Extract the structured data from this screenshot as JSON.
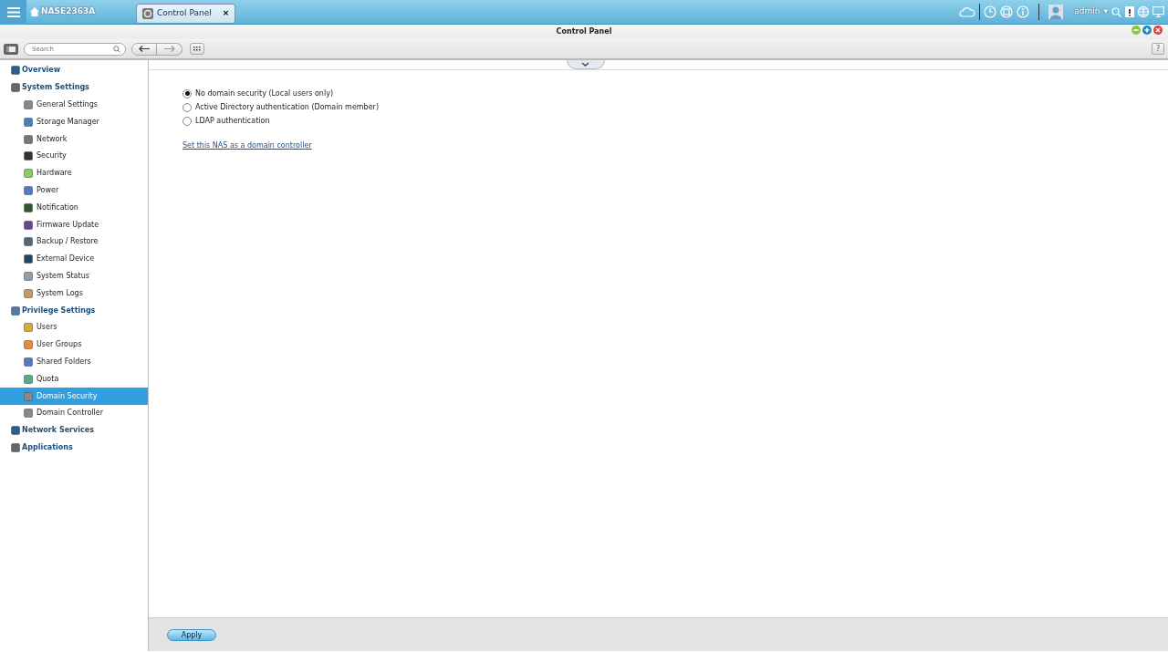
{
  "topbar": {
    "host": "NASE2363A",
    "tabs": [
      {
        "label": "Control Panel",
        "selected": true
      }
    ],
    "close": "×",
    "user": "admin",
    "user_caret": "▾"
  },
  "window": {
    "title": "Control Panel",
    "help": "?"
  },
  "toolbar": {
    "search": {
      "placeholder": "Search"
    }
  },
  "sidebar": {
    "items": [
      {
        "label": "Overview",
        "selected": false
      },
      {
        "label": "System Settings",
        "selected": false,
        "children": [
          {
            "label": "General Settings",
            "selected": false
          },
          {
            "label": "Storage Manager",
            "selected": false
          },
          {
            "label": "Network",
            "selected": false
          },
          {
            "label": "Security",
            "selected": false
          },
          {
            "label": "Hardware",
            "selected": false
          },
          {
            "label": "Power",
            "selected": false
          },
          {
            "label": "Notification",
            "selected": false
          },
          {
            "label": "Firmware Update",
            "selected": false
          },
          {
            "label": "Backup / Restore",
            "selected": false
          },
          {
            "label": "External Device",
            "selected": false
          },
          {
            "label": "System Status",
            "selected": false
          },
          {
            "label": "System Logs",
            "selected": false
          }
        ]
      },
      {
        "label": "Privilege Settings",
        "selected": false,
        "children": [
          {
            "label": "Users",
            "selected": false
          },
          {
            "label": "User Groups",
            "selected": false
          },
          {
            "label": "Shared Folders",
            "selected": false
          },
          {
            "label": "Quota",
            "selected": false
          },
          {
            "label": "Domain Security",
            "selected": true
          },
          {
            "label": "Domain Controller",
            "selected": false
          }
        ]
      },
      {
        "label": "Network Services",
        "selected": false
      },
      {
        "label": "Applications",
        "selected": false
      }
    ]
  },
  "content": {
    "options": [
      {
        "label": "No domain security (Local users only)",
        "selected": true
      },
      {
        "label": "Active Directory authentication (Domain member)",
        "selected": false
      },
      {
        "label": "LDAP authentication",
        "selected": false
      }
    ],
    "link": "Set this NAS as a domain controller"
  },
  "footer": {
    "apply": "Apply"
  }
}
